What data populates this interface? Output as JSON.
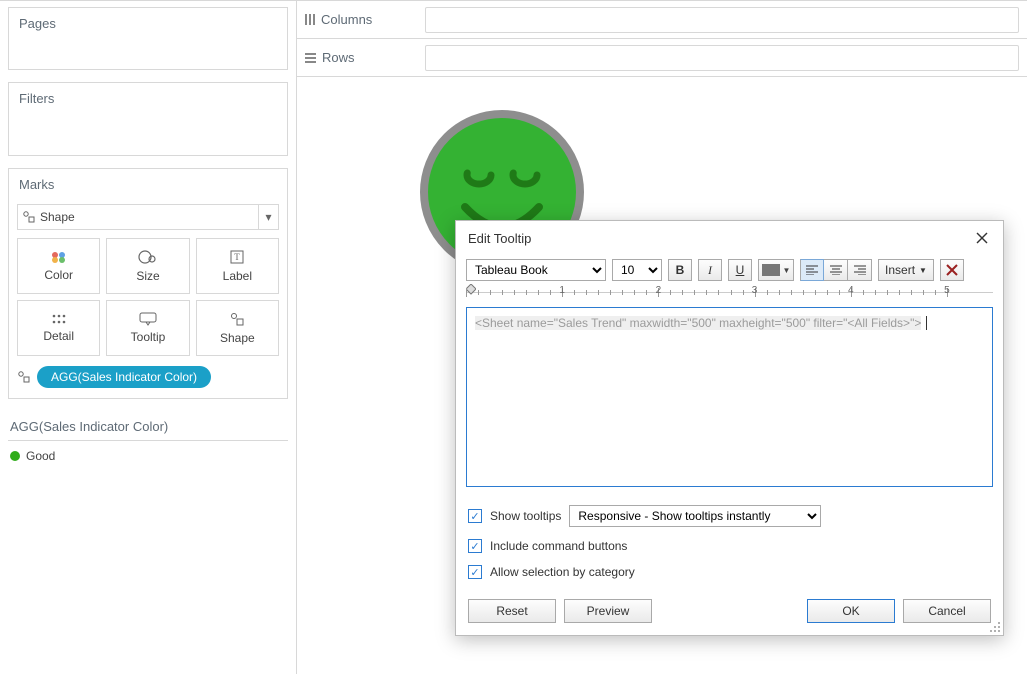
{
  "sidebar": {
    "pages_title": "Pages",
    "filters_title": "Filters",
    "marks_title": "Marks",
    "shape_dropdown_label": "Shape",
    "mark_buttons": {
      "color": "Color",
      "size": "Size",
      "label": "Label",
      "detail": "Detail",
      "tooltip": "Tooltip",
      "shape": "Shape"
    },
    "pill_label": "AGG(Sales Indicator Color)"
  },
  "legend": {
    "title": "AGG(Sales Indicator Color)",
    "items": [
      {
        "label": "Good",
        "color": "#2fac1a"
      }
    ]
  },
  "shelves": {
    "columns": "Columns",
    "rows": "Rows"
  },
  "dialog": {
    "title": "Edit Tooltip",
    "font_family": "Tableau Book",
    "font_size": "10",
    "insert_label": "Insert",
    "ruler_numbers": [
      "1",
      "2",
      "3",
      "4",
      "5"
    ],
    "editor_text": "<Sheet name=\"Sales Trend\" maxwidth=\"500\" maxheight=\"500\" filter=\"<All Fields>\">",
    "show_tooltips_label": "Show tooltips",
    "show_tooltips_mode": "Responsive - Show tooltips instantly",
    "include_command_buttons_label": "Include command buttons",
    "allow_selection_label": "Allow selection by category",
    "reset_label": "Reset",
    "preview_label": "Preview",
    "ok_label": "OK",
    "cancel_label": "Cancel",
    "checked": {
      "show_tooltips": true,
      "include_command_buttons": true,
      "allow_selection": true
    }
  },
  "canvas": {
    "indicator_shape": "happy-face",
    "indicator_color": "#34b233"
  }
}
